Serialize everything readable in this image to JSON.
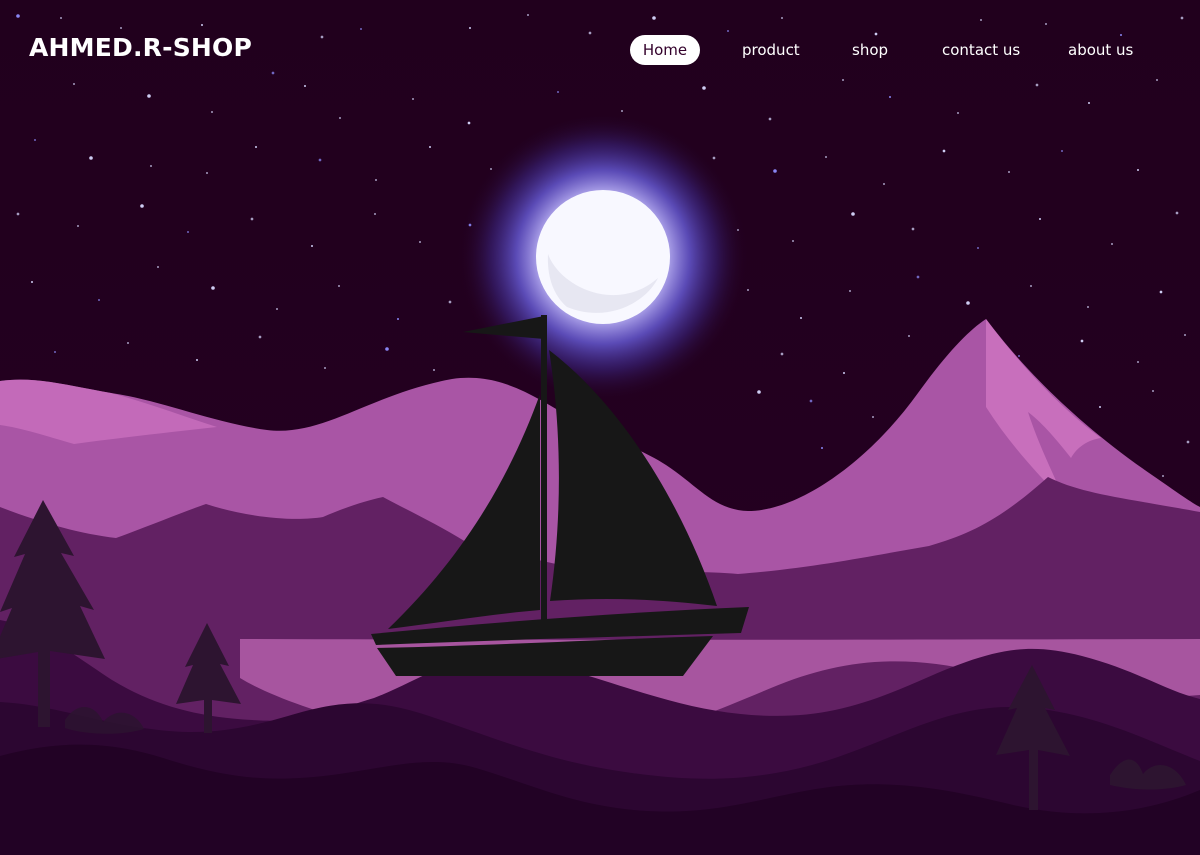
{
  "brand": {
    "name": "AHMED.R-SHOP"
  },
  "nav": {
    "items": [
      {
        "label": "Home",
        "active": true
      },
      {
        "label": "product",
        "active": false
      },
      {
        "label": "shop",
        "active": false
      },
      {
        "label": "contact us",
        "active": false
      },
      {
        "label": "about us",
        "active": false
      }
    ]
  },
  "scene": {
    "icons": [
      "moon-icon",
      "sailboat-icon",
      "pine-tree-icon",
      "mountain-icon",
      "star-icon"
    ],
    "colors": {
      "night_sky": "#22001f",
      "moon": "#f8f8ff",
      "moon_glow": "#6d63e8",
      "mountain_light": "#a955a5",
      "mountain_highlight": "#cd73c0",
      "mountain_mid": "#622163",
      "lake": "#a7559f",
      "foreground": "#2c0631",
      "boat": "#171717"
    }
  }
}
